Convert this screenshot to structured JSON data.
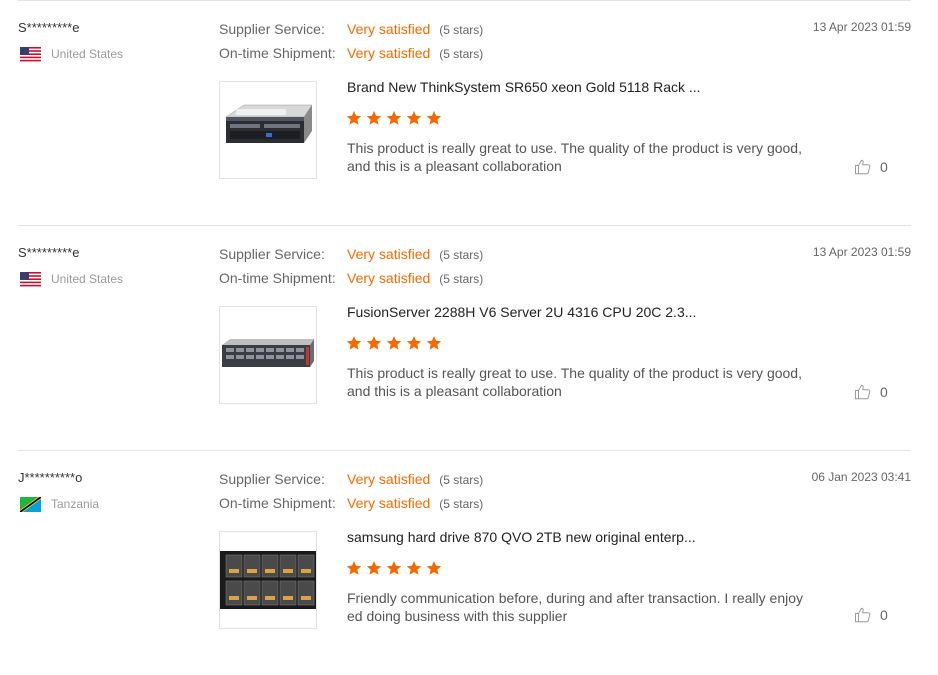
{
  "reviews": [
    {
      "buyer": "S*********e",
      "country": "United States",
      "flag_icon": "us-flag-icon",
      "supplier_service": {
        "label": "Supplier Service:",
        "value": "Very satisfied",
        "stars_text": "(5 stars)"
      },
      "shipment": {
        "label": "On-time Shipment:",
        "value": "Very satisfied",
        "stars_text": "(5 stars)"
      },
      "date": "13 Apr 2023 01:59",
      "product_title": "Brand New ThinkSystem SR650 xeon Gold 5118 Rack ...",
      "rating": 5,
      "text": "This product is really great to use. The quality of the product is very good, and this is a pleasant collaboration",
      "likes": "0"
    },
    {
      "buyer": "S*********e",
      "country": "United States",
      "flag_icon": "us-flag-icon",
      "supplier_service": {
        "label": "Supplier Service:",
        "value": "Very satisfied",
        "stars_text": "(5 stars)"
      },
      "shipment": {
        "label": "On-time Shipment:",
        "value": "Very satisfied",
        "stars_text": "(5 stars)"
      },
      "date": "13 Apr 2023 01:59",
      "product_title": "FusionServer 2288H V6 Server 2U 4316 CPU 20C 2.3...",
      "rating": 5,
      "text": "This product is really great to use. The quality of the product is very good, and this is a pleasant collaboration",
      "likes": "0"
    },
    {
      "buyer": "J**********o",
      "country": "Tanzania",
      "flag_icon": "tanzania-flag-icon",
      "supplier_service": {
        "label": "Supplier Service:",
        "value": "Very satisfied",
        "stars_text": "(5 stars)"
      },
      "shipment": {
        "label": "On-time Shipment:",
        "value": "Very satisfied",
        "stars_text": "(5 stars)"
      },
      "date": "06 Jan 2023 03:41",
      "product_title": "samsung hard drive 870 QVO 2TB new original enterp...",
      "rating": 5,
      "text": "Friendly communication before, during and after transaction. I really enjoy ed doing business with this supplier",
      "likes": "0"
    }
  ],
  "colors": {
    "accent": "#f56a00",
    "divider": "#e4e4e4"
  }
}
